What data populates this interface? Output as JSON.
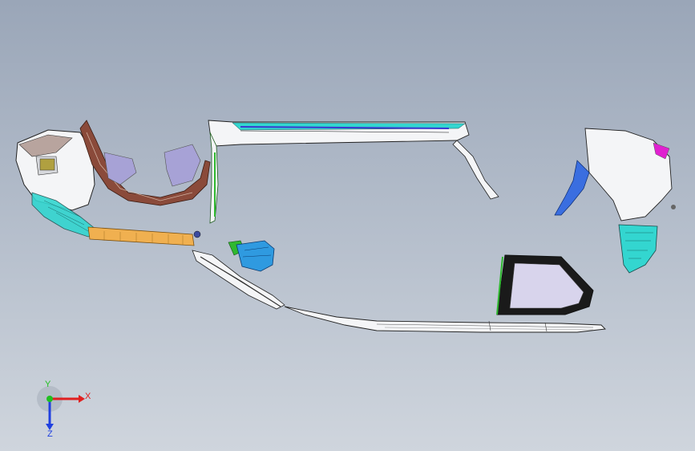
{
  "viewport": {
    "background_top": "#9aa6b8",
    "background_bottom": "#cfd5dd"
  },
  "model_parts": [
    "front-bumper-assembly",
    "front-wheel-arch-liner",
    "mud-flaps",
    "rocker-beam",
    "roof-rail",
    "a-pillar-trim",
    "side-mirror",
    "door-lower-trim",
    "rear-quarter-glass",
    "rocker-panel-sill",
    "rear-bumper-corner"
  ],
  "colors": {
    "part_white": "#f4f5f7",
    "wireframe": "#111111",
    "cyan": "#33d6d0",
    "blue": "#3a6ee0",
    "orange": "#f0b050",
    "green": "#2fb82f",
    "brown": "#8a4a3a",
    "lavender": "#a7a2d6",
    "magenta": "#e020d0"
  },
  "triad": {
    "x_label": "X",
    "y_label": "Y",
    "z_label": "Z",
    "x_color": "#e02020",
    "y_color": "#20c020",
    "z_color": "#2040e0"
  }
}
